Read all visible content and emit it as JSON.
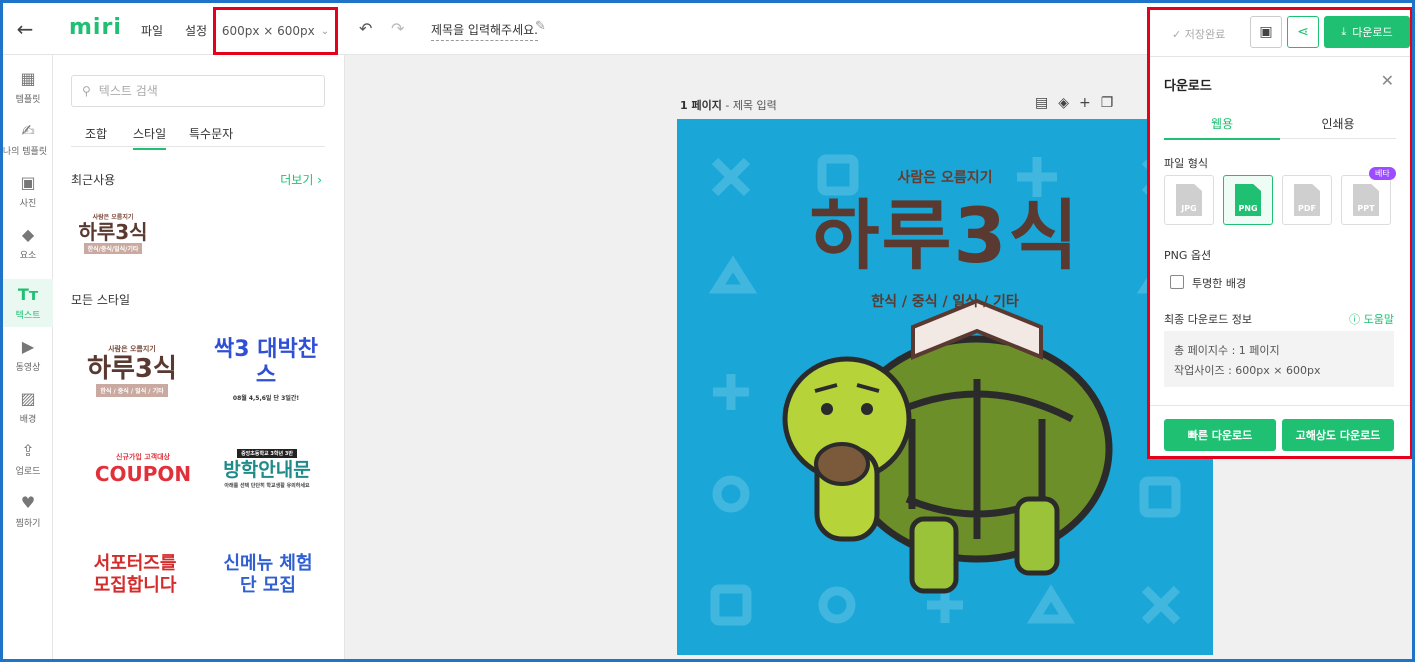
{
  "app": {
    "logo": "miri"
  },
  "topbar": {
    "back_icon": "arrow-left-icon",
    "menu": [
      "파일",
      "설정"
    ],
    "size_label": "600px × 600px",
    "document_title": "제목을 입력해주세요."
  },
  "rail": [
    {
      "label": "템플릿",
      "icon": "layout-icon"
    },
    {
      "label": "나의 템플릿",
      "icon": "user-edit-icon"
    },
    {
      "label": "사진",
      "icon": "image-icon"
    },
    {
      "label": "요소",
      "icon": "shapes-icon"
    },
    {
      "label": "텍스트",
      "icon": "text-icon",
      "active": true
    },
    {
      "label": "동영상",
      "icon": "play-icon"
    },
    {
      "label": "배경",
      "icon": "pattern-icon"
    },
    {
      "label": "업로드",
      "icon": "upload-icon"
    },
    {
      "label": "찜하기",
      "icon": "heart-icon"
    }
  ],
  "panel": {
    "search_placeholder": "텍스트 검색",
    "tabs": [
      "조합",
      "스타일",
      "특수문자"
    ],
    "active_tab": "스타일",
    "recent_title": "최근사용",
    "more_label": "더보기",
    "all_title": "모든 스타일",
    "recent_item": {
      "small": "사람은 오름지기",
      "title": "하루3식",
      "sub": "한식/중식/일식/기타"
    },
    "styles": [
      {
        "small": "사람은 오름지기",
        "title": "하루3식",
        "sub": "한식 / 중식 / 일식 / 기타"
      },
      {
        "title": "싹3 대박찬스",
        "sub": "08월 4,5,6일 단 3일간!"
      },
      {
        "small": "신규가입 고객대상",
        "title": "COUPON"
      },
      {
        "small": "중앙초등학교 3학년 3반",
        "title": "방학안내문",
        "sub": "아래를 선택 단단히 학교생활 유의하세요"
      },
      {
        "title": "서포터즈를 모집합니다"
      },
      {
        "title": "신메뉴 체험단 모집"
      }
    ]
  },
  "canvas": {
    "page_label": "1 페이지",
    "page_title_placeholder": "제목 입력",
    "headline_small": "사람은 오름지기",
    "headline": "하루3식",
    "banner": "한식 / 중식 / 일식 / 기타",
    "background": "#1aa6d6"
  },
  "download": {
    "saved_label": "저장완료",
    "download_button": "다운로드",
    "panel_title": "다운로드",
    "tabs": [
      "웹용",
      "인쇄용"
    ],
    "file_format_label": "파일 형식",
    "formats": [
      "JPG",
      "PNG",
      "PDF",
      "PPT"
    ],
    "selected_format": "PNG",
    "beta_label": "베타",
    "png_options_label": "PNG 옵션",
    "transparent_bg_label": "투명한 배경",
    "transparent_checked": false,
    "final_info_label": "최종 다운로드 정보",
    "help_label": "도움말",
    "total_pages": "총 페이지수 : 1 페이지",
    "work_size": "작업사이즈 : 600px × 600px",
    "fast_download": "빠른 다운로드",
    "hq_download": "고해상도 다운로드"
  },
  "colors": {
    "brand": "#20c073",
    "highlight": "#e5001b",
    "frame": "#1f73c9"
  }
}
